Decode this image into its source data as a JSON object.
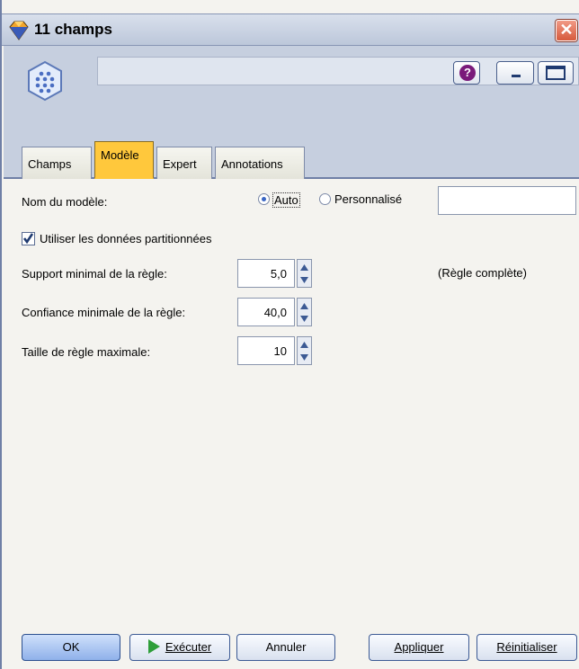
{
  "window": {
    "title": "11 champs",
    "close_glyph": "✕",
    "icon": "diamond-node-icon"
  },
  "header": {
    "node_icon": "apriori-node-icon",
    "help_glyph": "?",
    "help_icon": "help-icon",
    "minimize_icon": "minimize-icon",
    "maximize_icon": "maximize-icon"
  },
  "tabs": [
    {
      "label": "Champs",
      "active": false
    },
    {
      "label": "Modèle",
      "active": true
    },
    {
      "label": "Expert",
      "active": false
    },
    {
      "label": "Annotations",
      "active": false
    }
  ],
  "model": {
    "name_label": "Nom du modèle:",
    "auto_label": "Auto",
    "custom_label": "Personnalisé",
    "selected": "Auto",
    "custom_value": "",
    "use_partitioned_label": "Utiliser les données partitionnées",
    "use_partitioned_checked": true,
    "min_support_label": "Support minimal de la règle:",
    "min_support_value": "5,0",
    "rule_note": "(Règle complète)",
    "min_confidence_label": "Confiance minimale de la règle:",
    "min_confidence_value": "40,0",
    "max_rule_size_label": "Taille de règle maximale:",
    "max_rule_size_value": "10"
  },
  "footer": {
    "ok": "OK",
    "run": "Exécuter",
    "cancel": "Annuler",
    "apply": "Appliquer",
    "reset": "Réinitialiser"
  },
  "colors": {
    "active_tab": "#ffc83c",
    "header_bg": "#c6cfdf",
    "run_icon": "#2e9e3a",
    "check_mark": "#1f3a70"
  }
}
